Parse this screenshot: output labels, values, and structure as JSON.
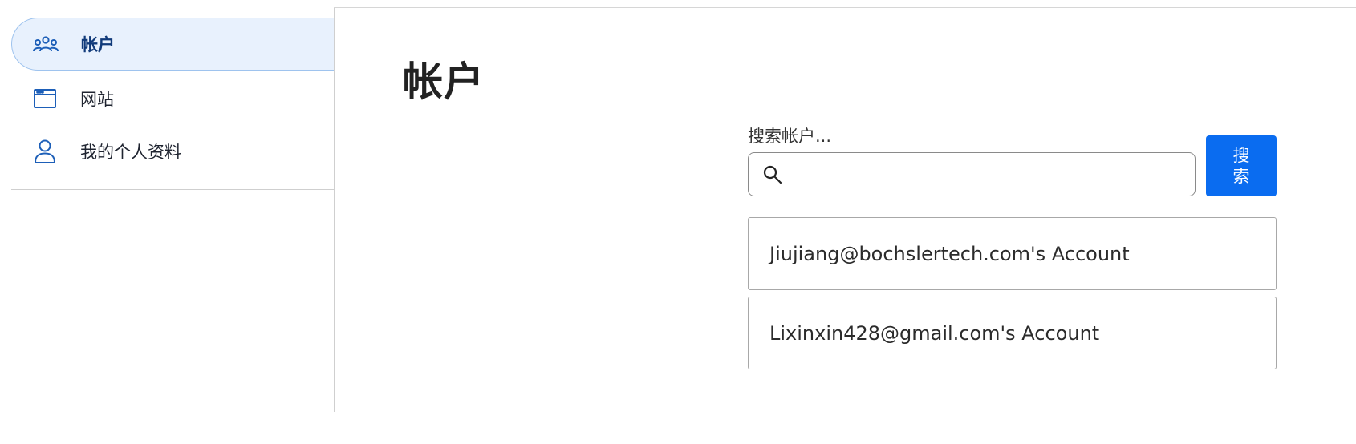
{
  "sidebar": {
    "items": [
      {
        "label": "帐户",
        "icon": "users-icon",
        "active": true
      },
      {
        "label": "网站",
        "icon": "browser-window-icon",
        "active": false
      },
      {
        "label": "我的个人资料",
        "icon": "person-icon",
        "active": false
      }
    ]
  },
  "main": {
    "title": "帐户",
    "search": {
      "label": "搜索帐户...",
      "value": "",
      "placeholder": "",
      "button_label": "搜索"
    },
    "accounts": [
      {
        "name": "Jiujiang@bochslertech.com's Account"
      },
      {
        "name": "Lixinxin428@gmail.com's Account"
      }
    ]
  },
  "colors": {
    "accent": "#0a6cf0",
    "active_bg": "#e8f1fd",
    "icon": "#1d5fb8"
  }
}
